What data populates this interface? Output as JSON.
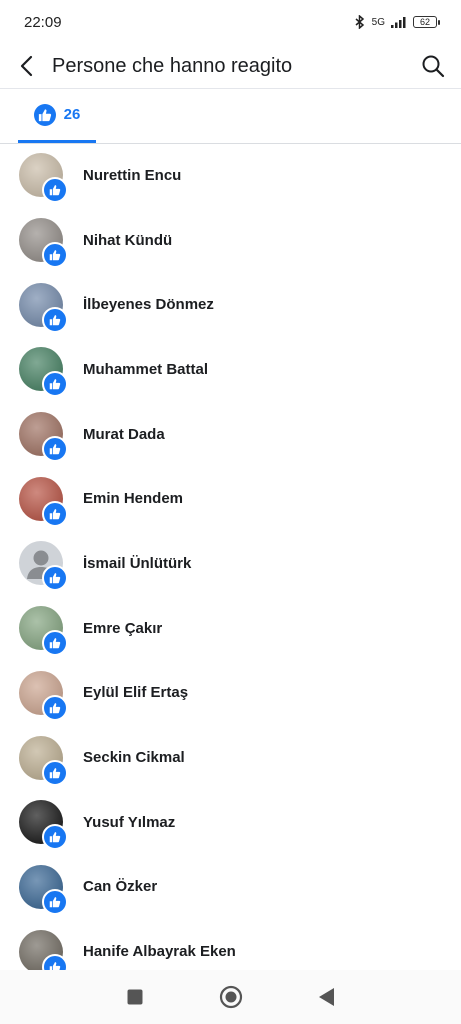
{
  "status": {
    "time": "22:09",
    "network": "5G",
    "battery": "62"
  },
  "header": {
    "title": "Persone che hanno reagito"
  },
  "tabs": [
    {
      "count": "26"
    }
  ],
  "reactors": [
    {
      "name": "Nurettin Encu",
      "avatar": "photo-group",
      "color": "#c7b9a4"
    },
    {
      "name": "Nihat Kündü",
      "avatar": "photo-man",
      "color": "#8d8782"
    },
    {
      "name": "İlbeyenes Dönmez",
      "avatar": "photo-cat",
      "color": "#6c84a6"
    },
    {
      "name": "Muhammet Battal",
      "avatar": "photo-lake",
      "color": "#3c7a5a"
    },
    {
      "name": "Murat Dada",
      "avatar": "photo-crowd",
      "color": "#9a6a5a"
    },
    {
      "name": "Emin Hendem",
      "avatar": "photo-red",
      "color": "#b44a3a"
    },
    {
      "name": "İsmail Ünlütürk",
      "avatar": "default-avatar",
      "color": "#cfd3d8"
    },
    {
      "name": "Emre Çakır",
      "avatar": "photo-park",
      "color": "#7ea07a"
    },
    {
      "name": "Eylül Elif Ertaş",
      "avatar": "photo-girl",
      "color": "#c9a08a"
    },
    {
      "name": "Seckin Cikmal",
      "avatar": "photo-couple",
      "color": "#b9aa8c"
    },
    {
      "name": "Yusuf Yılmaz",
      "avatar": "photo-dark",
      "color": "#0a0a0a"
    },
    {
      "name": "Can Özker",
      "avatar": "photo-globe",
      "color": "#2f5f8f"
    },
    {
      "name": "Hanife Albayrak Eken",
      "avatar": "photo-street",
      "color": "#6a645a"
    }
  ],
  "colors": {
    "accent": "#1877f2",
    "text": "#1c1e21"
  }
}
